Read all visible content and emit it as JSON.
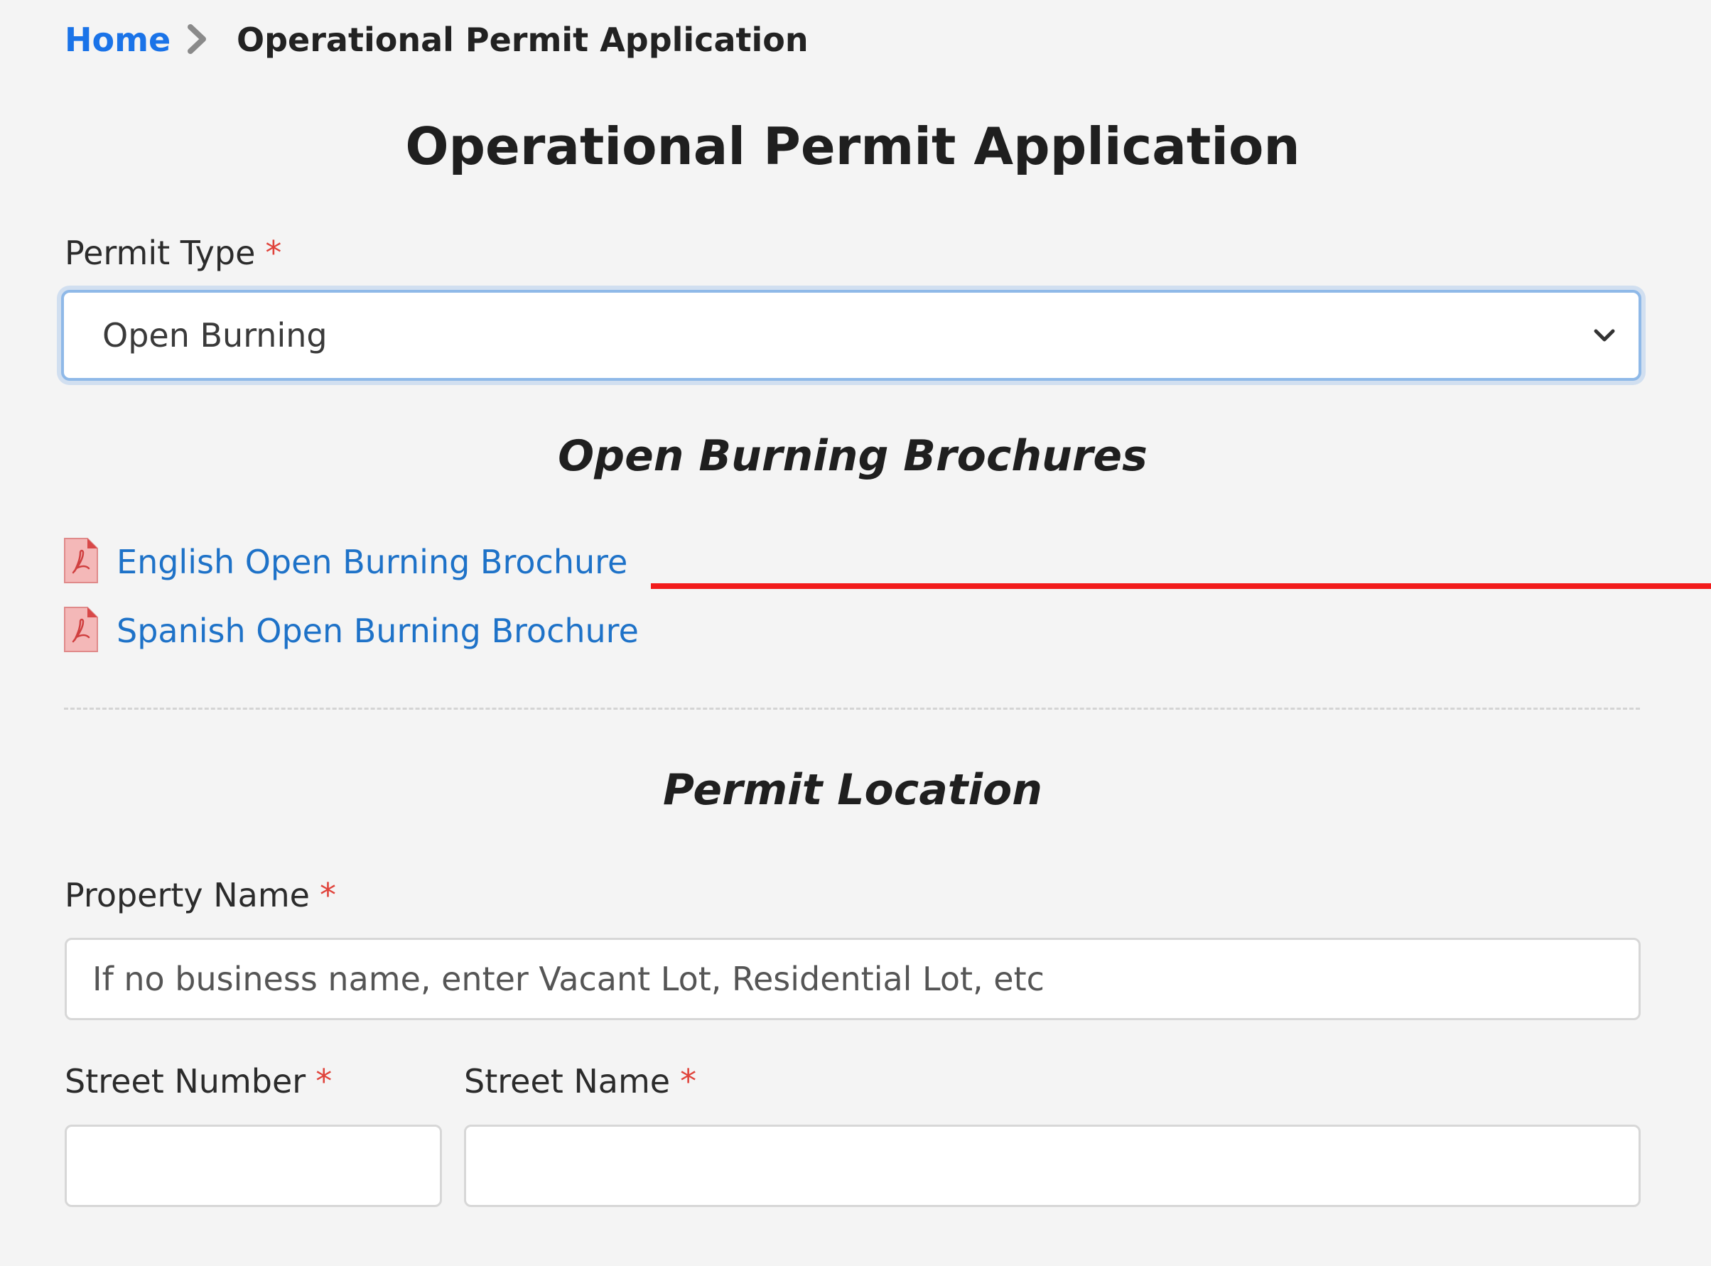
{
  "breadcrumb": {
    "home": "Home",
    "current": "Operational Permit Application"
  },
  "page": {
    "title": "Operational Permit Application"
  },
  "permit_type": {
    "label": "Permit Type",
    "required_mark": "*",
    "selected": "Open Burning"
  },
  "brochures": {
    "title": "Open Burning Brochures",
    "items": [
      {
        "label": "English Open Burning Brochure",
        "icon": "pdf-file-icon"
      },
      {
        "label": "Spanish Open Burning Brochure",
        "icon": "pdf-file-icon"
      }
    ]
  },
  "location": {
    "title": "Permit Location",
    "property_name": {
      "label": "Property Name",
      "required_mark": "*",
      "value": "",
      "placeholder": "If no business name, enter Vacant Lot, Residential Lot, etc"
    },
    "street_number": {
      "label": "Street Number",
      "required_mark": "*",
      "value": ""
    },
    "street_name": {
      "label": "Street Name",
      "required_mark": "*",
      "value": ""
    }
  },
  "colors": {
    "background": "#f4f4f4",
    "link": "#1e72c8",
    "home_link": "#1a73e8",
    "required": "#e0433b",
    "annotation": "#f21b1b",
    "focus_border": "#8fb9e8"
  }
}
